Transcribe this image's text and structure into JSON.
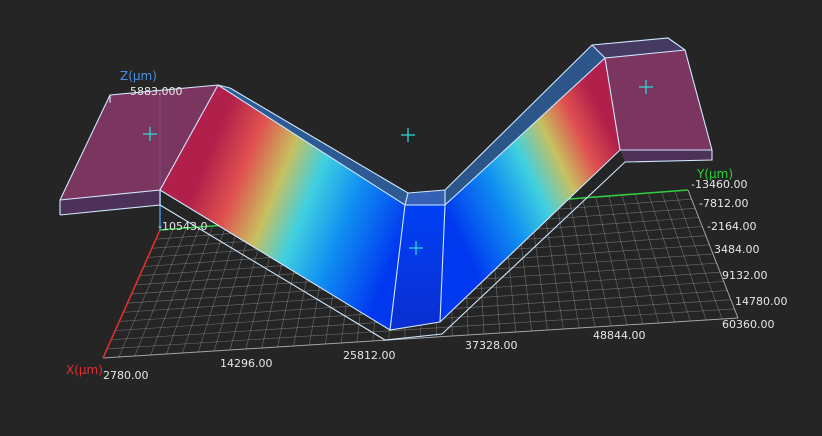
{
  "viewer": {
    "colors": {
      "background": "#252526",
      "grid": "#d8d8d8",
      "x_axis": "#e03030",
      "y_axis": "#30d040",
      "z_axis": "#4a90e2",
      "tick_text": "#e6e6e6",
      "wireframe": "#cfe8ff",
      "marker": "#2fe0e0"
    },
    "axes": {
      "x": {
        "label": "X(μm)",
        "ticks": [
          "2780.00",
          "14296.00",
          "25812.00",
          "37328.00",
          "48844.00",
          "60360.00"
        ]
      },
      "y": {
        "label": "Y(μm)",
        "ticks": [
          "-13460.00",
          "-7812.00",
          "-2164.00",
          "3484.00",
          "9132.00",
          "14780.00"
        ]
      },
      "z": {
        "label": "Z(μm)",
        "max_label": "5883.000",
        "min_label": "-10543.0"
      }
    },
    "markers": [
      "plus-marker-left",
      "plus-marker-top",
      "plus-marker-center",
      "plus-marker-right"
    ]
  }
}
